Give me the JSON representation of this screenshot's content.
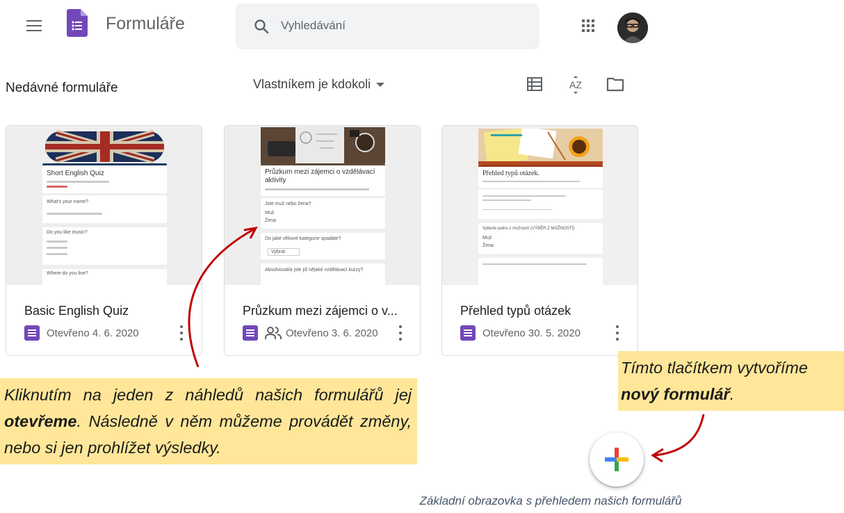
{
  "header": {
    "app_title": "Formuláře",
    "search_placeholder": "Vyhledávání"
  },
  "toolbar": {
    "section_title": "Nedávné formuláře",
    "owner_filter": "Vlastníkem je kdokoli",
    "sort_label": "AZ"
  },
  "cards": [
    {
      "title": "Basic English Quiz",
      "opened": "Otevřeno 4. 6. 2020",
      "shared": false,
      "preview": {
        "form_title": "Short English Quiz",
        "q1": "What's your name?",
        "q2": "Do you like music?",
        "q3": "Where do you live?"
      }
    },
    {
      "title": "Průzkum mezi zájemci o v...",
      "opened": "Otevřeno 3. 6. 2020",
      "shared": true,
      "preview": {
        "form_title": "Průzkum mezi zájemci o vzdělávací aktivity",
        "q1": "Jste muž nebo žena?",
        "opt1": "Muž",
        "opt2": "Žena",
        "q2": "Do jaké věkové kategorie spadáte?",
        "dropdown": "Vybrat",
        "q3": "Absolvoval/a jste již nějaké vzdělávací kurzy?"
      }
    },
    {
      "title": "Přehled typů otázek",
      "opened": "Otevřeno 30. 5. 2020",
      "shared": false,
      "preview": {
        "form_title": "Přehled typů otázek.",
        "q1": "Vyberte jednu z možností (VÝBĚR Z MOŽNOSTÍ)",
        "opt1": "Muž",
        "opt2": "Žena"
      }
    }
  ],
  "annotations": {
    "open_note_part1": "Kliknutím na jeden z náhledů našich formulářů jej ",
    "open_note_bold": "otevřeme",
    "open_note_part2": ". Následně v něm můžeme provádět změny, nebo si jen prohlížet výsledky.",
    "new_note_part1": "Tímto tlačítkem vytvoříme ",
    "new_note_bold": "nový formulář",
    "new_note_part2": "."
  },
  "caption": "Základní obrazovka s přehledem našich formulářů",
  "colors": {
    "forms_purple": "#7248b9",
    "note_background": "#ffe699",
    "arrow_red": "#c00000"
  }
}
